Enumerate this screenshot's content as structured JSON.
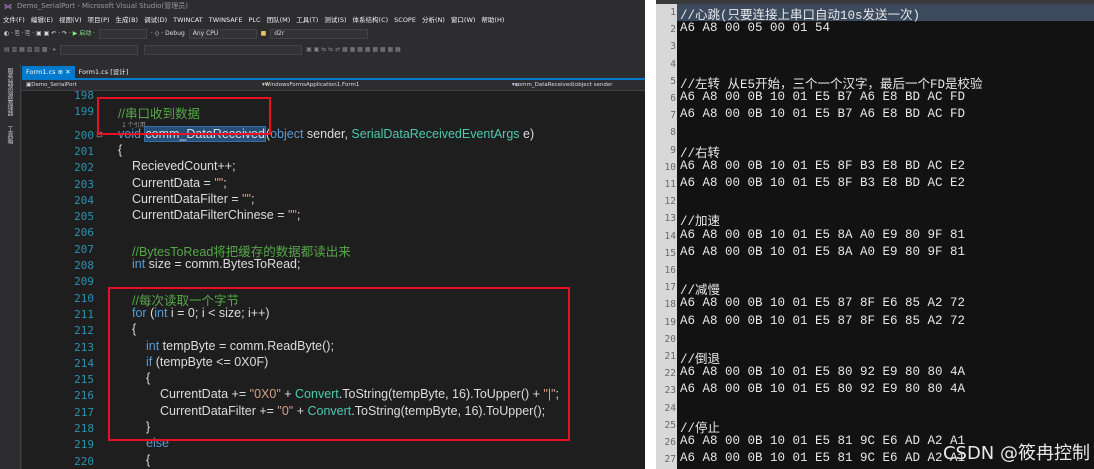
{
  "vs": {
    "title": "Demo_SerialPort - Microsoft Visual Studio(管理员)",
    "menu": [
      "文件(F)",
      "编辑(E)",
      "视图(V)",
      "项目(P)",
      "生成(B)",
      "调试(D)",
      "TWINCAT",
      "TWINSAFE",
      "PLC",
      "团队(M)",
      "工具(T)",
      "测试(S)",
      "体系结构(C)",
      "SCOPE",
      "分析(N)",
      "窗口(W)",
      "帮助(H)"
    ],
    "toolbar": {
      "debug_label": "Debug",
      "cpu_label": "Any CPU",
      "start_label": "▶ 启动 ·",
      "project_label": "d2r"
    },
    "sidebar_tabs": [
      "服务器资源管理器",
      "工具箱"
    ],
    "doc_tabs": [
      {
        "label": "Form1.cs",
        "close": "✕"
      },
      {
        "label": "Form1.cs [设计]"
      }
    ],
    "nav": {
      "project": "Demo_SerialPort",
      "class": "WindowsFormsApplication1.Form1",
      "member": "comm_DataReceived(object sender"
    },
    "ref_hint": "1 个引用",
    "lines": [
      {
        "n": "198",
        "text": ""
      },
      {
        "n": "199",
        "text": "//串口收到数据"
      },
      {
        "n": "200",
        "text": "void comm_DataReceived(object sender, SerialDataReceivedEventArgs e)"
      },
      {
        "n": "201",
        "text": "{"
      },
      {
        "n": "202",
        "text": "RecievedCount++;"
      },
      {
        "n": "203",
        "text": "CurrentData = \"\";"
      },
      {
        "n": "204",
        "text": "CurrentDataFilter = \"\";"
      },
      {
        "n": "205",
        "text": "CurrentDataFilterChinese = \"\";"
      },
      {
        "n": "206",
        "text": ""
      },
      {
        "n": "207",
        "text": "//BytesToRead将把缓存的数据都读出来"
      },
      {
        "n": "208",
        "text": "int size = comm.BytesToRead;"
      },
      {
        "n": "209",
        "text": ""
      },
      {
        "n": "210",
        "text": "//每次读取一个字节"
      },
      {
        "n": "211",
        "text": "for (int i = 0; i < size; i++)"
      },
      {
        "n": "212",
        "text": "{"
      },
      {
        "n": "213",
        "text": "int tempByte = comm.ReadByte();"
      },
      {
        "n": "214",
        "text": "if (tempByte <= 0X0F)"
      },
      {
        "n": "215",
        "text": "{"
      },
      {
        "n": "216",
        "text": "CurrentData += \"0X0\" + Convert.ToString(tempByte, 16).ToUpper() + \"|\";"
      },
      {
        "n": "217",
        "text": "CurrentDataFilter += \"0\" + Convert.ToString(tempByte, 16).ToUpper();"
      },
      {
        "n": "218",
        "text": "}"
      },
      {
        "n": "219",
        "text": "else"
      },
      {
        "n": "220",
        "text": "{"
      }
    ]
  },
  "hex": {
    "lines": [
      {
        "n": "1",
        "text": "//心跳(只要连接上串口自动10s发送一次)"
      },
      {
        "n": "2",
        "text": "A6 A8 00 05 00 01 54"
      },
      {
        "n": "3",
        "text": ""
      },
      {
        "n": "4",
        "text": ""
      },
      {
        "n": "5",
        "text": "//左转 从E5开始，三个一个汉字，最后一个FD是校验"
      },
      {
        "n": "6",
        "text": "A6 A8 00 0B 10 01 E5 B7 A6 E8 BD AC FD"
      },
      {
        "n": "7",
        "text": "A6 A8 00 0B 10 01 E5 B7 A6 E8 BD AC FD"
      },
      {
        "n": "8",
        "text": ""
      },
      {
        "n": "9",
        "text": "//右转"
      },
      {
        "n": "10",
        "text": "A6 A8 00 0B 10 01 E5 8F B3 E8 BD AC E2"
      },
      {
        "n": "11",
        "text": "A6 A8 00 0B 10 01 E5 8F B3 E8 BD AC E2"
      },
      {
        "n": "12",
        "text": ""
      },
      {
        "n": "13",
        "text": "//加速"
      },
      {
        "n": "14",
        "text": "A6 A8 00 0B 10 01 E5 8A A0 E9 80 9F 81"
      },
      {
        "n": "15",
        "text": "A6 A8 00 0B 10 01 E5 8A A0 E9 80 9F 81"
      },
      {
        "n": "16",
        "text": ""
      },
      {
        "n": "17",
        "text": "//减慢"
      },
      {
        "n": "18",
        "text": "A6 A8 00 0B 10 01 E5 87 8F E6 85 A2 72"
      },
      {
        "n": "19",
        "text": "A6 A8 00 0B 10 01 E5 87 8F E6 85 A2 72"
      },
      {
        "n": "20",
        "text": ""
      },
      {
        "n": "21",
        "text": "//倒退"
      },
      {
        "n": "22",
        "text": "A6 A8 00 0B 10 01 E5 80 92 E9 80 80 4A"
      },
      {
        "n": "23",
        "text": "A6 A8 00 0B 10 01 E5 80 92 E9 80 80 4A"
      },
      {
        "n": "24",
        "text": ""
      },
      {
        "n": "25",
        "text": "//停止"
      },
      {
        "n": "26",
        "text": "A6 A8 00 0B 10 01 E5 81 9C E6 AD A2 A1"
      },
      {
        "n": "27",
        "text": "A6 A8 00 0B 10 01 E5 81 9C E6 AD A2 A1"
      }
    ],
    "watermark": "CSDN @筱冉控制"
  }
}
